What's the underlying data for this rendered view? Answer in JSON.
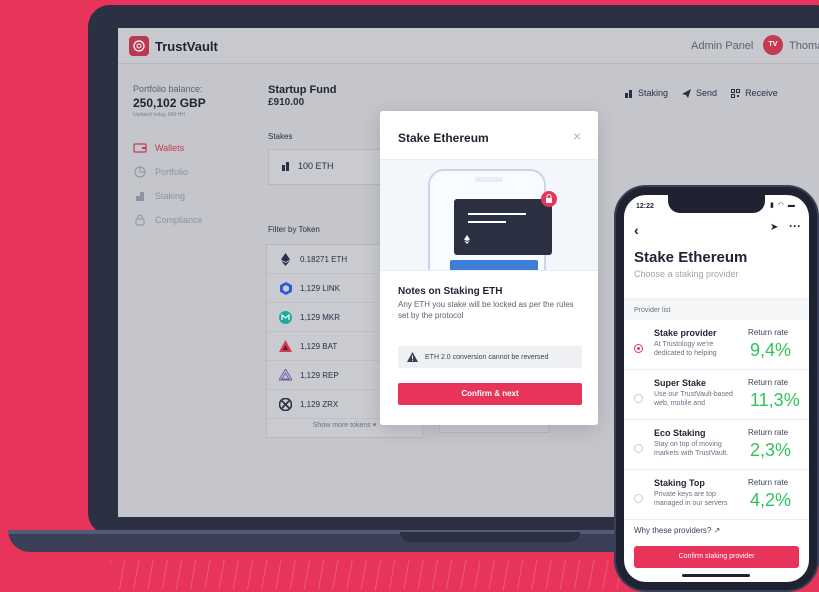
{
  "colors": {
    "accent": "#e8345a",
    "positive": "#2fc45a",
    "laptop": "#2b3042"
  },
  "app": {
    "brand": "TrustVault",
    "admin_link": "Admin Panel",
    "avatar_initials": "TV",
    "username": "Thomas"
  },
  "sidebar": {
    "balance_label": "Portfolio balance:",
    "balance_value": "250,102 GBP",
    "balance_updated": "Updated today, MM:HH",
    "items": [
      {
        "label": "Wallets",
        "icon": "wallet-icon",
        "active": true
      },
      {
        "label": "Portfolio",
        "icon": "pie-chart-icon",
        "active": false
      },
      {
        "label": "Staking",
        "icon": "coins-icon",
        "active": false
      },
      {
        "label": "Compliance",
        "icon": "lock-icon",
        "active": false
      }
    ]
  },
  "main": {
    "fund_title": "Startup Fund",
    "fund_value": "£910.00",
    "actions": [
      {
        "label": "Staking",
        "icon": "coins-icon"
      },
      {
        "label": "Send",
        "icon": "send-icon"
      },
      {
        "label": "Receive",
        "icon": "qr-icon"
      }
    ],
    "stakes_label": "Stakes",
    "stakes_value": "100 ETH",
    "filter_label": "Filter by Token",
    "tokens": [
      {
        "amount": "0.18271 ETH",
        "icon": "eth-icon"
      },
      {
        "amount": "1,129 LINK",
        "icon": "link-icon"
      },
      {
        "amount": "1,129 MKR",
        "icon": "mkr-icon"
      },
      {
        "amount": "1,129 BAT",
        "icon": "bat-icon"
      },
      {
        "amount": "1,129 REP",
        "icon": "rep-icon"
      },
      {
        "amount": "1,129 ZRX",
        "icon": "zrx-icon"
      }
    ],
    "show_more": "Show more tokens"
  },
  "modal": {
    "title": "Stake Ethereum",
    "close": "×",
    "notes_title": "Notes on Staking ETH",
    "notes_text": "Any ETH you stake will be locked as per the rules set by the protocol",
    "warning": "ETH 2.0 conversion cannot be reversed",
    "confirm": "Confirm & next"
  },
  "phone": {
    "time": "12:22",
    "title": "Stake Ethereum",
    "subtitle": "Choose a staking provider",
    "list_label": "Provider list",
    "providers": [
      {
        "name": "Stake provider",
        "desc": "At Trustology we're dedicated to helping",
        "rr_label": "Return rate",
        "rate": "9,4%",
        "selected": true
      },
      {
        "name": "Super Stake",
        "desc": "Use our TrustVault-based web, mobile and",
        "rr_label": "Return rate",
        "rate": "11,3%",
        "selected": false
      },
      {
        "name": "Eco Staking",
        "desc": "Stay on top of moving markets with TrustVault.",
        "rr_label": "Return rate",
        "rate": "2,3%",
        "selected": false
      },
      {
        "name": "Staking Top",
        "desc": "Private keys are top managed in our servers",
        "rr_label": "Return rate",
        "rate": "4,2%",
        "selected": false
      }
    ],
    "why_link": "Why these providers?",
    "confirm": "Confirm staking provider"
  }
}
